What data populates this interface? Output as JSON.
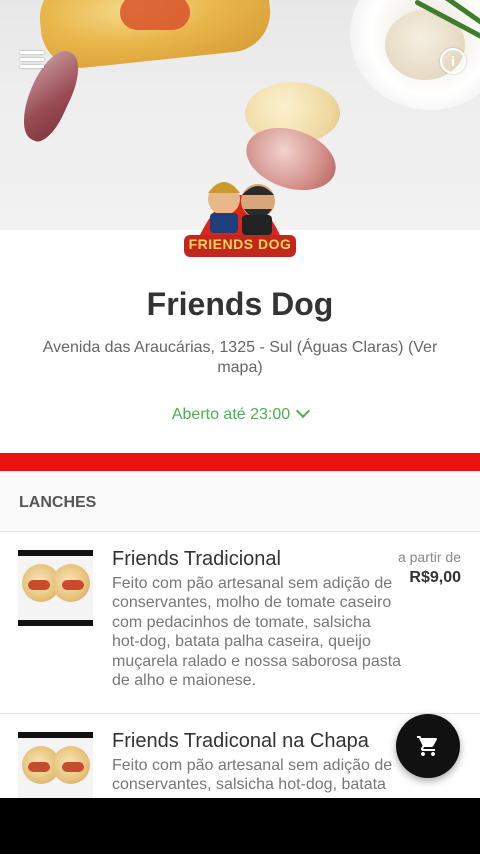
{
  "store": {
    "name": "Friends Dog",
    "address": "Avenida das Araucárias, 1325 - Sul (Águas Claras) (Ver mapa)",
    "status": "Aberto até 23:00",
    "logo_text": "FRIENDS DOG"
  },
  "menu": {
    "section_title": "LANCHES",
    "items": [
      {
        "name": "Friends Tradicional",
        "description": "Feito com pão artesanal sem adição de conservantes, molho de tomate caseiro com pedacinhos de tomate, salsicha hot-dog, batata palha caseira, queijo muçarela ralado e nossa saborosa pasta de alho e maionese.",
        "from_label": "a partir de",
        "price": "R$9,00"
      },
      {
        "name": "Friends Tradiconal na Chapa",
        "description": "Feito com pão artesanal sem adição de conservantes, salsicha hot-dog, batata"
      }
    ]
  },
  "icons": {
    "menu": "hamburger-menu-icon",
    "info": "info-icon",
    "status_toggle": "chevron-down-icon",
    "cart": "shopping-cart-icon"
  },
  "colors": {
    "accent_green": "#4caf50",
    "brand_red": "#e91212",
    "fab": "#111111"
  }
}
